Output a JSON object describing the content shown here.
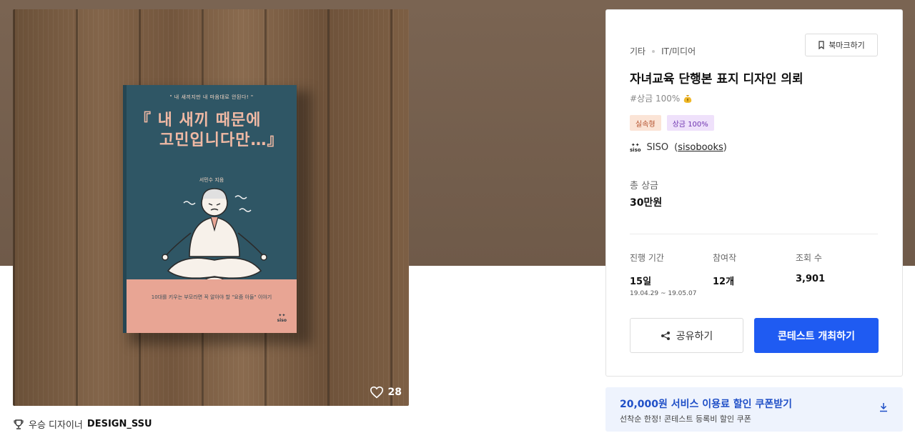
{
  "hero": {
    "book": {
      "tagline": "\" 내 새끼지만 내 마음대로 안된다! \"",
      "title_line1": "『 내 새끼 때문에",
      "title_line2": "고민입니다만…』",
      "author": "서민수 지음",
      "band_text": "10대를 키우는 부모라면 꼭 알아야 할 \"요즘 아들\" 이야기",
      "logo": "siso"
    },
    "likes": "28",
    "icons": {
      "likes": "heart-icon"
    }
  },
  "winner": {
    "prefix": "우승 디자이너",
    "name": "DESIGN_SSU",
    "icon": "trophy-icon"
  },
  "card": {
    "breadcrumb": [
      "기타",
      "IT/미디어"
    ],
    "bookmark_label": "북마크하기",
    "title": "자녀교육 단행본 표지 디자인 의뢰",
    "hashtag": "#상금 100%",
    "badges": [
      "실속형",
      "상금 100%"
    ],
    "organizer": {
      "logo": "siso",
      "name": "SISO",
      "handle": "sisobooks"
    },
    "prize_label": "총 상금",
    "prize_value": "30만원",
    "stats": [
      {
        "label": "진행 기간",
        "value": "15일",
        "sub": "19.04.29 ~ 19.05.07"
      },
      {
        "label": "참여작",
        "value": "12개",
        "sub": ""
      },
      {
        "label": "조회 수",
        "value": "3,901",
        "sub": ""
      }
    ],
    "share_label": "공유하기",
    "host_label": "콘테스트 개최하기",
    "colors": {
      "primary": "#1f5bf2",
      "badge1_bg": "#fbe4d6",
      "badge2_bg": "#efe1fb"
    }
  },
  "coupon": {
    "title": "20,000원 서비스 이용료 할인 쿠폰받기",
    "subtitle": "선착순 한정! 콘테스트 등록비 할인 쿠폰",
    "icon": "download-icon"
  }
}
